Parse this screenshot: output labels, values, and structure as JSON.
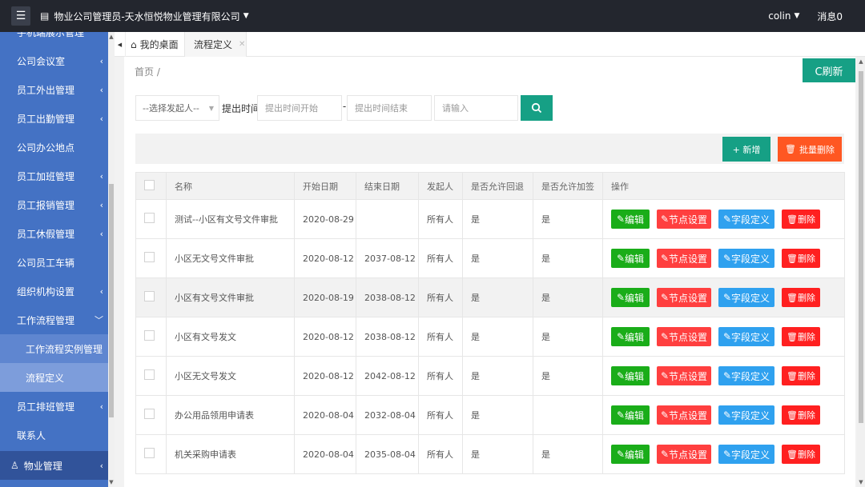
{
  "header": {
    "org_title": "物业公司管理员-天水恒悦物业管理有限公司",
    "user": "colin",
    "messages": "消息0"
  },
  "sidebar": {
    "items": [
      {
        "label": "手机端展示管理",
        "chev": false,
        "kind": "top-partial"
      },
      {
        "label": "公司会议室",
        "chev": true
      },
      {
        "label": "员工外出管理",
        "chev": true
      },
      {
        "label": "员工出勤管理",
        "chev": true
      },
      {
        "label": "公司办公地点",
        "chev": false
      },
      {
        "label": "员工加班管理",
        "chev": true
      },
      {
        "label": "员工报销管理",
        "chev": true
      },
      {
        "label": "员工休假管理",
        "chev": true
      },
      {
        "label": "公司员工车辆",
        "chev": false
      },
      {
        "label": "组织机构设置",
        "chev": true
      },
      {
        "label": "工作流程管理",
        "chev": true,
        "expanded": true
      },
      {
        "label": "工作流程实例管理",
        "sub": true
      },
      {
        "label": "流程定义",
        "sub": true,
        "active": true
      },
      {
        "label": "员工排班管理",
        "chev": true
      },
      {
        "label": "联系人",
        "chev": false
      },
      {
        "label": "物业管理",
        "chev": true,
        "bottom": true
      }
    ]
  },
  "tabs": {
    "home": "我的桌面",
    "current": "流程定义"
  },
  "breadcrumb": "首页 /",
  "refresh_label": "C刷新",
  "filter": {
    "initiator_select": "--选择发起人--",
    "time_label": "提出时间:",
    "start_placeholder": "提出时间开始",
    "end_placeholder": "提出时间结束",
    "keyword_placeholder": "请输入"
  },
  "toolbar": {
    "add_label": "+ 新增",
    "batch_delete_label": "批量删除"
  },
  "table": {
    "headers": [
      "名称",
      "开始日期",
      "结束日期",
      "发起人",
      "是否允许回退",
      "是否允许加签",
      "操作"
    ],
    "rows": [
      {
        "name": "测试--小区有文号文件审批",
        "start": "2020-08-29",
        "end": "",
        "initiator": "所有人",
        "rollback": "是",
        "countersign": "是"
      },
      {
        "name": "小区无文号文件审批",
        "start": "2020-08-12",
        "end": "2037-08-12",
        "initiator": "所有人",
        "rollback": "是",
        "countersign": "是"
      },
      {
        "name": "小区有文号文件审批",
        "start": "2020-08-19",
        "end": "2038-08-12",
        "initiator": "所有人",
        "rollback": "是",
        "countersign": "是"
      },
      {
        "name": "小区有文号发文",
        "start": "2020-08-12",
        "end": "2038-08-12",
        "initiator": "所有人",
        "rollback": "是",
        "countersign": "是"
      },
      {
        "name": "小区无文号发文",
        "start": "2020-08-12",
        "end": "2042-08-12",
        "initiator": "所有人",
        "rollback": "是",
        "countersign": "是"
      },
      {
        "name": "办公用品领用申请表",
        "start": "2020-08-04",
        "end": "2032-08-04",
        "initiator": "所有人",
        "rollback": "是",
        "countersign": ""
      },
      {
        "name": "机关采购申请表",
        "start": "2020-08-04",
        "end": "2035-08-04",
        "initiator": "所有人",
        "rollback": "是",
        "countersign": "是"
      }
    ],
    "actions": {
      "edit": "编辑",
      "node": "节点设置",
      "field": "字段定义",
      "delete": "删除"
    }
  },
  "colors": {
    "topbar": "#23262e",
    "sidebar": "#4472c4",
    "primary": "#16a085",
    "danger": "#ff5722"
  }
}
